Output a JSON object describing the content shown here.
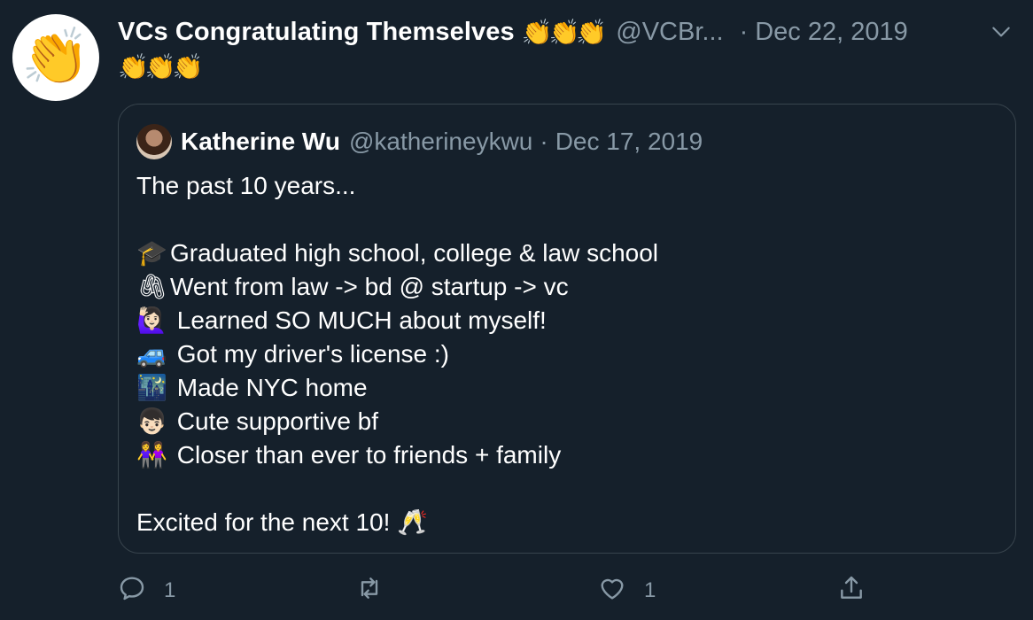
{
  "tweet": {
    "avatar_icon": "clapping-hands-icon",
    "avatar_emoji": "👏",
    "display_name": "VCs Congratulating Themselves",
    "name_emoji": "👏👏👏",
    "name_emoji_cont": "👏👏👏",
    "handle": "@VCBr...",
    "dot": "·",
    "date": "Dec 22, 2019",
    "menu_icon": "chevron-down-icon"
  },
  "quote": {
    "author_name": "Katherine Wu",
    "handle": "@katherineykwu",
    "dot": "·",
    "date": "Dec 17, 2019",
    "intro": "The past 10 years...",
    "items": [
      {
        "emoji": "🎓",
        "text": "Graduated high school, college & law school"
      },
      {
        "emoji": "🖇",
        "text": "Went from law -> bd @ startup -> vc"
      },
      {
        "emoji": "🙋🏻‍♀️",
        "text": " Learned SO MUCH about myself!"
      },
      {
        "emoji": "🚙",
        "text": " Got my driver's license :)"
      },
      {
        "emoji": "🌃",
        "text": " Made NYC home"
      },
      {
        "emoji": "👦🏻",
        "text": " Cute supportive bf"
      },
      {
        "emoji": "👭",
        "text": " Closer than ever to friends + family"
      }
    ],
    "outro": "Excited for the next 10!",
    "outro_emoji": "🥂"
  },
  "actions": {
    "reply_count": "1",
    "retweet_count": "",
    "like_count": "1",
    "icons": [
      "reply-icon",
      "retweet-icon",
      "like-icon",
      "share-icon"
    ]
  },
  "colors": {
    "background": "#15202b",
    "secondary_text": "#8899a6",
    "border": "#38444d",
    "primary_text": "#ffffff"
  }
}
